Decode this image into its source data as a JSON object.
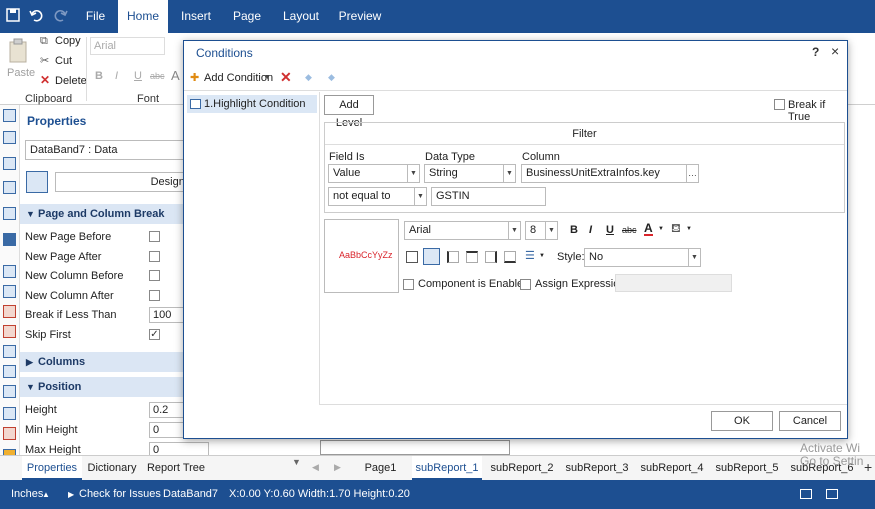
{
  "ribbon_tabs": {
    "file": "File",
    "home": "Home",
    "insert": "Insert",
    "page": "Page",
    "layout": "Layout",
    "preview": "Preview"
  },
  "ribbon": {
    "paste": "Paste",
    "copy": "Copy",
    "cut": "Cut",
    "delete": "Delete",
    "clipboard_group": "Clipboard",
    "font_group": "Font",
    "font_name": "Arial"
  },
  "properties": {
    "title": "Properties",
    "selected": "DataBand7 : Data",
    "designer_button": "Design...",
    "sections": {
      "page_column_break": "Page and Column Break",
      "columns": "Columns",
      "position": "Position"
    },
    "rows": [
      {
        "label": "New Page Before"
      },
      {
        "label": "New Page After"
      },
      {
        "label": "New Column Before"
      },
      {
        "label": "New Column After"
      },
      {
        "label": "Break if Less Than",
        "value": "100"
      },
      {
        "label": "Skip First",
        "checked": true
      }
    ],
    "position_rows": [
      {
        "label": "Height",
        "value": "0.2"
      },
      {
        "label": "Min Height",
        "value": "0"
      },
      {
        "label": "Max Height",
        "value": "0"
      }
    ]
  },
  "bottom_tabs": {
    "properties": "Properties",
    "dictionary": "Dictionary",
    "report_tree": "Report Tree",
    "pages": [
      "Page1",
      "subReport_1",
      "subReport_2",
      "subReport_3",
      "subReport_4",
      "subReport_5",
      "subReport_6"
    ]
  },
  "status": {
    "units": "Inches",
    "check": "Check for Issues",
    "component": "DataBand7",
    "coords": "X:0.00 Y:0.60 Width:1.70 Height:0.20"
  },
  "dialog": {
    "title": "Conditions",
    "help": "?",
    "close": "×",
    "add_condition": "Add Condition",
    "condition_item": "1.Highlight Condition",
    "add_level": "Add Level",
    "break_if_true": "Break if True",
    "filter_header": "Filter",
    "field_is_label": "Field Is",
    "data_type_label": "Data Type",
    "column_label": "Column",
    "field_is_value": "Value",
    "data_type_value": "String",
    "column_value": "BusinessUnitExtraInfos.key",
    "operator_value": "not equal to",
    "compare_value": "GSTIN",
    "sample_text": "AaBbCcYyZz",
    "font_name": "Arial",
    "font_size": "8",
    "bold": "B",
    "italic": "I",
    "underline": "U",
    "strike": "abc",
    "style_label": "Style:",
    "style_value": "No",
    "component_enabled": "Component is Enabled",
    "assign_expression": "Assign Expression",
    "ok": "OK",
    "cancel": "Cancel"
  },
  "watermark": {
    "line1": "Activate Wi",
    "line2": "Go to Settin"
  },
  "colors": {
    "brand": "#1d4f91",
    "sample_text": "#d9242b"
  }
}
